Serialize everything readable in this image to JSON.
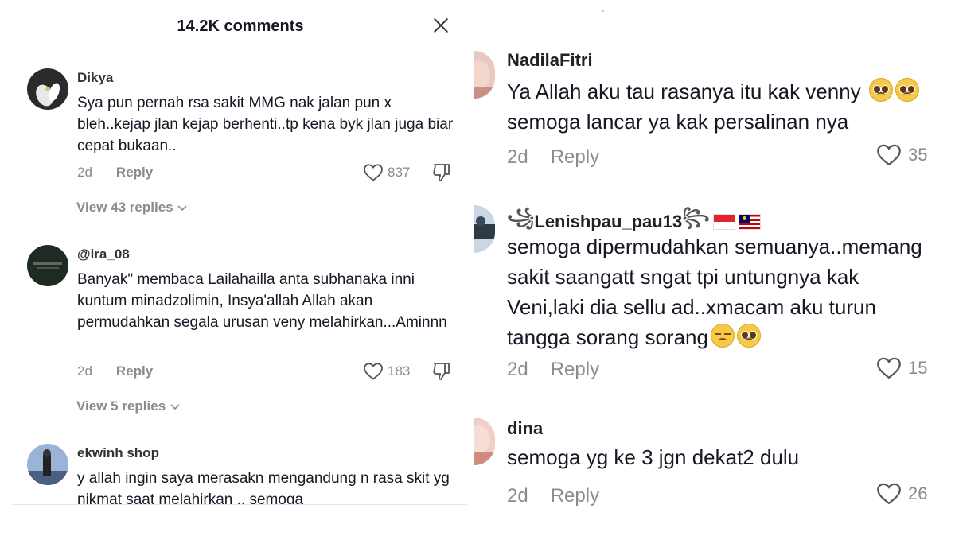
{
  "left_panel": {
    "header": {
      "title": "14.2K comments",
      "close_icon": "close-icon"
    },
    "comments": [
      {
        "username": "Dikya",
        "text": "Sya pun pernah rsa sakit MMG nak jalan pun x bleh..kejap jlan kejap berhenti..tp kena byk jlan juga biar cepat bukaan..",
        "time": "2d",
        "reply_label": "Reply",
        "likes": "837",
        "view_replies": "View 43 replies"
      },
      {
        "username": "@ira_08",
        "text": "Banyak\" membaca Lailahailla anta subhanaka inni kuntum minadzolimin, Insya'allah Allah akan permudahkan segala urusan veny melahirkan...Aminnn",
        "time": "2d",
        "reply_label": "Reply",
        "likes": "183",
        "view_replies": "View 5 replies"
      },
      {
        "username": "ekwinh shop",
        "text": "y allah ingin saya merasakn mengandung n rasa skit yg nikmat saat melahirkan .. semoga"
      }
    ]
  },
  "right_panel": {
    "comments": [
      {
        "username": "NadilaFitri",
        "lines": [
          "Ya Allah aku tau rasanya itu kak venny",
          "semoga lancar ya kak persalinan nya"
        ],
        "time": "2d",
        "reply_label": "Reply",
        "likes": "35"
      },
      {
        "username": "Lenishpau_pau13",
        "lines": [
          "semoga dipermudahkan semuanya..memang",
          "sakit saangatt sngat tpi untungnya kak",
          "Veni,laki dia sellu ad..xmacam aku turun",
          "tangga sorang sorang"
        ],
        "time": "2d",
        "reply_label": "Reply",
        "likes": "15"
      },
      {
        "username": "dina",
        "lines": [
          "semoga yg ke 3 jgn dekat2 dulu"
        ],
        "time": "2d",
        "reply_label": "Reply",
        "likes": "26"
      }
    ]
  },
  "colors": {
    "muted": "#8a8b91",
    "text": "#161823",
    "background": "#ffffff"
  },
  "icons": [
    "close-icon",
    "heart-icon",
    "dislike-icon",
    "chevron-down-icon",
    "pleading-face-emoji",
    "pensive-face-emoji",
    "wind-icon",
    "indonesia-flag",
    "malaysia-flag"
  ]
}
